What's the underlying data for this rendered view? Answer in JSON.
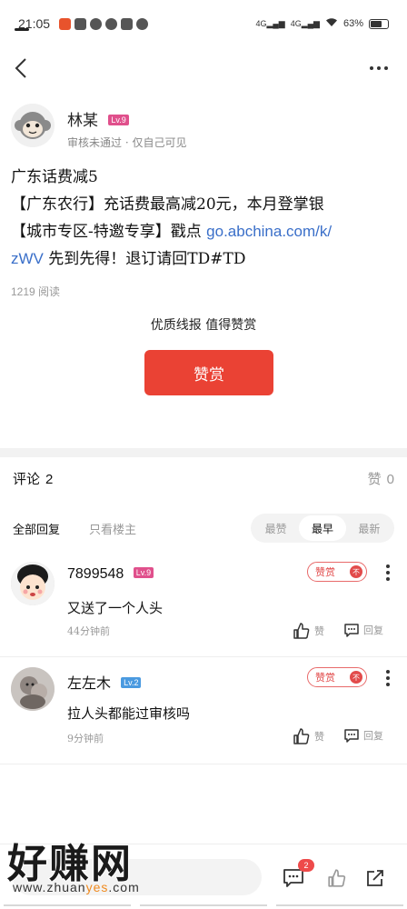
{
  "status_bar": {
    "time": "21:05",
    "net1": "4G",
    "net2": "4G",
    "battery": "63%"
  },
  "post": {
    "author_name": "林某",
    "author_level": "Lv.9",
    "author_status": "审核未通过 · 仅自己可见",
    "content_line1": "广东话费减5",
    "content_line2": "【广东农行】充话费最高减20元，本月登掌银",
    "content_line3_prefix": "【城市专区-特邀专享】戳点",
    "content_link_a": "go.abchina.com/k/",
    "content_link_b": "zWV",
    "content_line4_suffix": "先到先得！退订请回TD#TD",
    "read_count": "1219 阅读",
    "tip_slogan": "优质线报 值得赞赏",
    "tip_button": "赞赏"
  },
  "comments_section": {
    "title": "评论",
    "comment_count": "2",
    "likes_label": "赞",
    "likes_count": "0",
    "filter_all": "全部回复",
    "filter_owner": "只看楼主",
    "sort_options": [
      "最赞",
      "最早",
      "最新"
    ],
    "sort_active": "最早"
  },
  "comments": [
    {
      "user": "7899548",
      "level": "Lv.9",
      "reward_label": "赞赏",
      "reward_dot": "不",
      "text": "又送了一个人头",
      "time": "44分钟前",
      "like_label": "赞",
      "reply_label": "回复"
    },
    {
      "user": "左左木",
      "level": "Lv.2",
      "reward_label": "赞赏",
      "reward_dot": "不",
      "text": "拉人头都能过审核吗",
      "time": "9分钟前",
      "like_label": "赞",
      "reply_label": "回复"
    }
  ],
  "bottom_bar": {
    "message_badge": "2"
  },
  "watermark": {
    "cn": "好赚网",
    "url_prefix": "www.zhuan",
    "url_highlight": "yes",
    "url_suffix": ".com"
  },
  "colors": {
    "accent_red": "#ea4234",
    "link_blue": "#3a6fc9",
    "level_pink": "#e0508c",
    "level_blue": "#4a9ae0"
  }
}
